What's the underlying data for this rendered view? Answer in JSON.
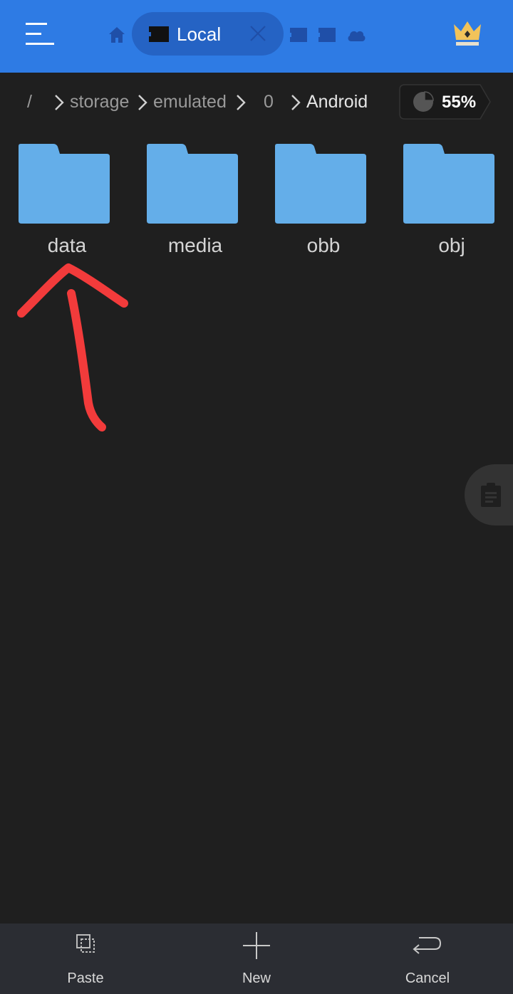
{
  "top_bar": {
    "active_tab_label": "Local",
    "icons": [
      "menu-icon",
      "home-icon",
      "sd-card-icon",
      "close-icon",
      "sd-card-icon",
      "sd-card-icon",
      "cloud-icon",
      "crown-icon"
    ]
  },
  "breadcrumb": {
    "root": "/",
    "items": [
      "storage",
      "emulated",
      "0",
      "Android"
    ]
  },
  "storage": {
    "usage_label": "55%",
    "usage_fraction": 0.55
  },
  "folders": [
    {
      "name": "data"
    },
    {
      "name": "media"
    },
    {
      "name": "obb"
    },
    {
      "name": "obj"
    }
  ],
  "bottom_bar": {
    "paste_label": "Paste",
    "new_label": "New",
    "cancel_label": "Cancel"
  },
  "colors": {
    "top_bar": "#2e7be4",
    "active_tab": "#2563c4",
    "background": "#1f1f1f",
    "folder": "#64aee9",
    "bottom_bar": "#2b2d33",
    "annotation": "#f23b3b",
    "crown": "#f2c35a"
  }
}
